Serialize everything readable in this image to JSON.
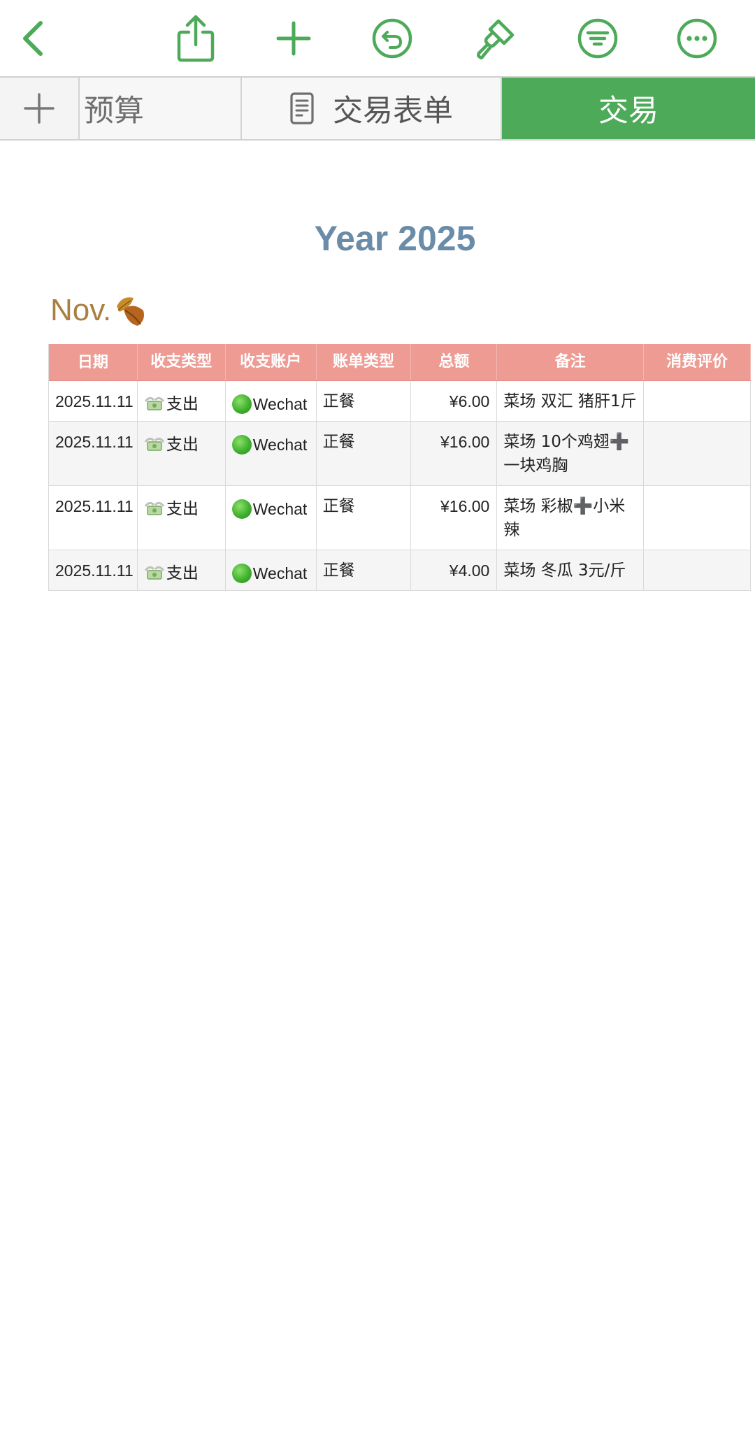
{
  "toolbar": {
    "icons": [
      "back-chevron-icon",
      "share-icon",
      "add-icon",
      "undo-icon",
      "format-brush-icon",
      "filter-icon",
      "more-icon"
    ],
    "accent": "#4caa58"
  },
  "tabs": {
    "add_icon": "plus-icon",
    "items": [
      {
        "label": "预算"
      },
      {
        "label": "交易表单",
        "icon": "form-icon"
      },
      {
        "label": "交易",
        "active": true
      }
    ]
  },
  "sheet": {
    "title": "Year 2025",
    "month": "Nov.",
    "month_icon": "fallen-leaf-icon"
  },
  "table": {
    "headers": [
      "日期",
      "收支类型",
      "收支账户",
      "账单类型",
      "总额",
      "备注",
      "消费评价"
    ],
    "header_color": "#ee9b94",
    "rows": [
      {
        "date": "2025.11.11",
        "kind": "支出",
        "account": "Wechat",
        "bill_type": "正餐",
        "amount": "¥6.00",
        "note": "菜场 双汇 猪肝1斤",
        "rating": ""
      },
      {
        "date": "2025.11.11",
        "kind": "支出",
        "account": "Wechat",
        "bill_type": "正餐",
        "amount": "¥16.00",
        "note": "菜场 10个鸡翅➕一块鸡胸",
        "rating": ""
      },
      {
        "date": "2025.11.11",
        "kind": "支出",
        "account": "Wechat",
        "bill_type": "正餐",
        "amount": "¥16.00",
        "note": "菜场 彩椒➕小米辣",
        "rating": ""
      },
      {
        "date": "2025.11.11",
        "kind": "支出",
        "account": "Wechat",
        "bill_type": "正餐",
        "amount": "¥4.00",
        "note": "菜场 冬瓜 3元/斤",
        "rating": ""
      }
    ]
  }
}
